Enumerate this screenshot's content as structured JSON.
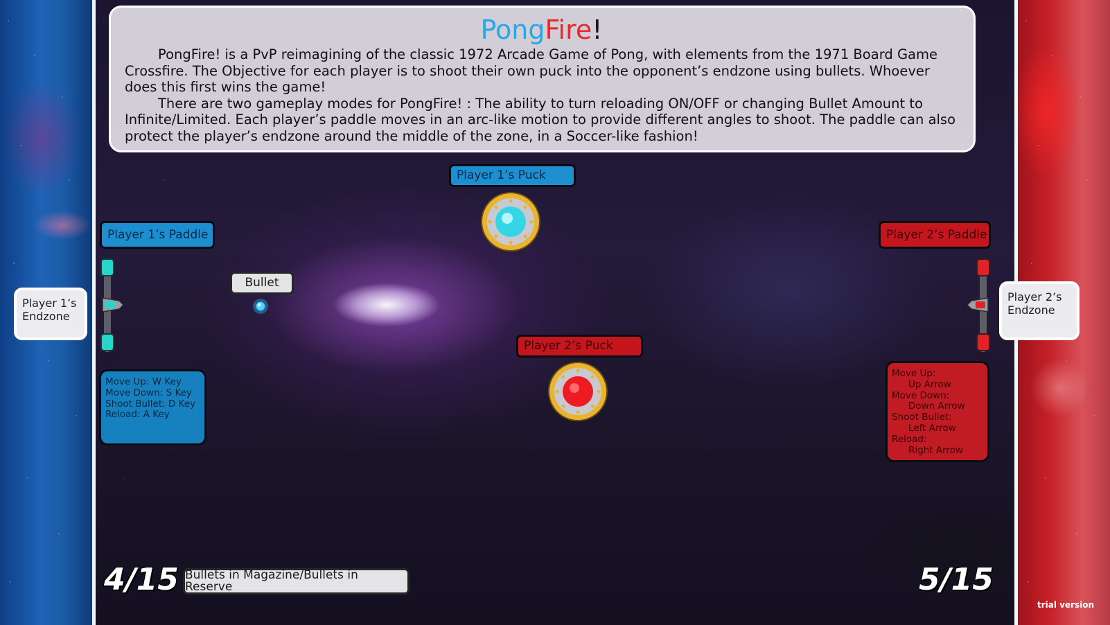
{
  "title": {
    "part1": "Pong",
    "part2": "Fire",
    "part3": "!"
  },
  "description": {
    "paragraph1": "PongFire! is a PvP reimagining of the classic 1972 Arcade Game of Pong, with elements from the 1971 Board Game Crossfire. The Objective for each player is to shoot their own puck into the opponent’s endzone using bullets. Whoever does this first wins the game!",
    "paragraph2": "There are two gameplay modes for PongFire! : The ability to turn reloading ON/OFF or changing Bullet Amount to Infinite/Limited. Each player’s paddle moves in an arc-like motion to provide different angles to shoot. The paddle can also protect the player’s endzone around the middle of the zone, in a Soccer-like fashion!"
  },
  "labels": {
    "p1_puck": "Player 1’s Puck",
    "p2_puck": "Player 2’s Puck",
    "p1_paddle": "Player 1’s Paddle",
    "p2_paddle": "Player 2’s Paddle",
    "bullet": "Bullet",
    "p1_endzone_line1": "Player 1’s",
    "p1_endzone_line2": "Endzone",
    "p2_endzone_line1": "Player 2’s",
    "p2_endzone_line2": "Endzone",
    "ammo_caption": "Bullets in Magazine/Bullets in Reserve"
  },
  "controls": {
    "p1": [
      "Move Up: W Key",
      "Move Down: S Key",
      "Shoot Bullet: D Key",
      "Reload: A Key"
    ],
    "p2": {
      "move_up": "Move Up:",
      "move_up_key": "Up Arrow",
      "move_down": "Move Down:",
      "move_down_key": "Down Arrow",
      "shoot": "Shoot Bullet:",
      "shoot_key": "Left Arrow",
      "reload": "Reload:",
      "reload_key": "Right Arrow"
    }
  },
  "counters": {
    "p1": "4/15",
    "p2": "5/15"
  },
  "footer": {
    "trial": "trial version"
  },
  "colors": {
    "player1": "#1d8fd0",
    "player2": "#c5161e",
    "puck_ring": "#e6b632"
  }
}
